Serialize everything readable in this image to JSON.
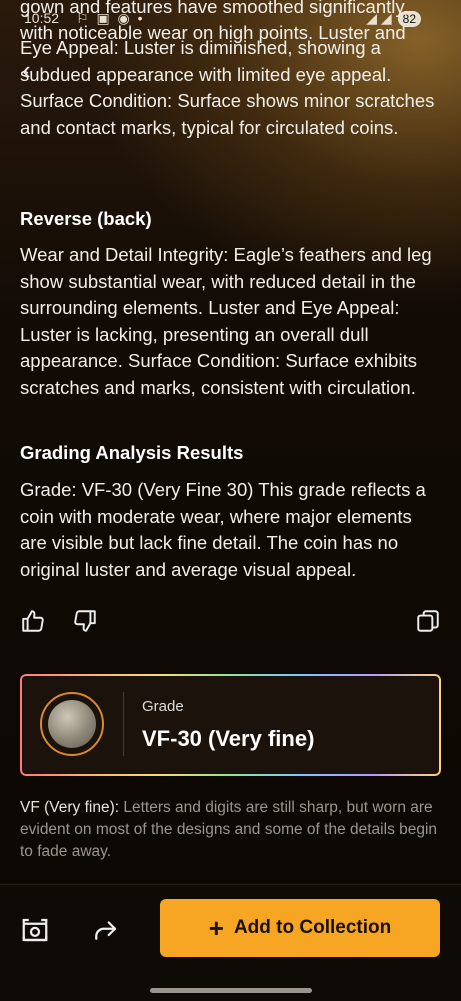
{
  "status_bar": {
    "time": "10:52",
    "icons": "⚐ ▣ ◉ •",
    "signal": "◢ ◢",
    "battery": "82"
  },
  "content": {
    "top_fragment_1": "gown and features have smoothed significantly,",
    "top_fragment_2": "with noticeable wear on high points. Luster and",
    "obverse_rest": "Eye Appeal: Luster is diminished, showing a subdued appearance with limited eye appeal. Surface Condition: Surface shows minor scratches and contact marks, typical for circulated coins.",
    "reverse_title": "Reverse (back)",
    "reverse_text": "Wear and Detail Integrity: Eagle’s feathers and leg show substantial wear, with reduced detail in the surrounding elements. Luster and Eye Appeal: Luster is lacking, presenting an overall dull appearance. Surface Condition: Surface exhibits scratches and marks, consistent with circulation.",
    "analysis_title": "Grading Analysis Results",
    "analysis_text": "Grade: VF-30 (Very Fine 30) This grade reflects a coin with moderate wear, where major elements are visible but lack fine detail. The coin has no original luster and average visual appeal."
  },
  "grade_card": {
    "label": "Grade",
    "value": "VF-30 (Very fine)"
  },
  "description": {
    "lead": "VF (Very fine):",
    "text": " Letters and digits are still sharp, but worn are evident on most of the designs and some of the details begin to fade away."
  },
  "bottom_bar": {
    "add_label": "Add to Collection"
  },
  "colors": {
    "accent": "#f6a623",
    "coin_ring": "#d88a2c"
  }
}
